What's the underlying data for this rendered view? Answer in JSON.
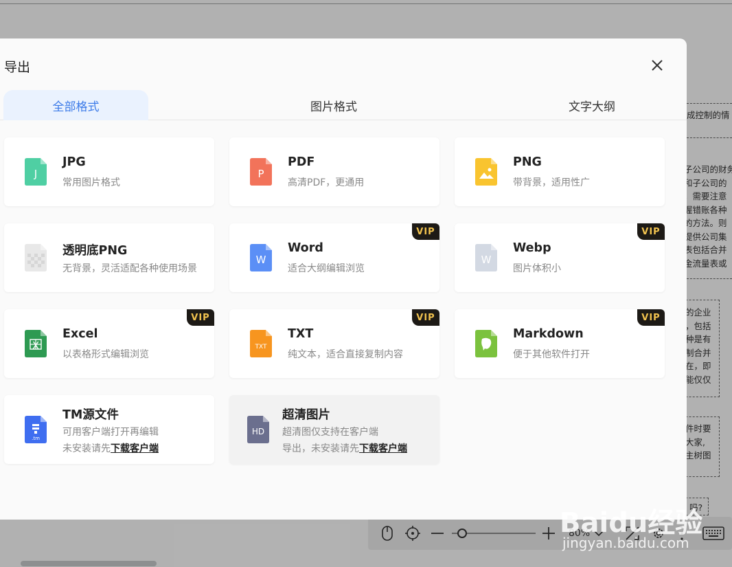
{
  "dialog": {
    "title": "导出",
    "tabs": [
      {
        "label": "全部格式",
        "active": true
      },
      {
        "label": "图片格式",
        "active": false
      },
      {
        "label": "文字大纲",
        "active": false
      }
    ]
  },
  "formats": [
    {
      "name": "JPG",
      "desc": "常用图片格式",
      "icon": "jpg-file-icon",
      "color": "#4fcfa3",
      "glyph": "J",
      "vip": false
    },
    {
      "name": "PDF",
      "desc": "高清PDF，更通用",
      "icon": "pdf-file-icon",
      "color": "#f2735a",
      "glyph": "P",
      "vip": false
    },
    {
      "name": "PNG",
      "desc": "带背景，适用性广",
      "icon": "png-file-icon",
      "color": "#f9c42f",
      "glyph": "",
      "vip": false
    },
    {
      "name": "透明底PNG",
      "desc": "无背景，灵活适配各种使用场景",
      "icon": "transparent-png-file-icon",
      "color": "#e8e8e8",
      "glyph": "",
      "vip": false
    },
    {
      "name": "Word",
      "desc": "适合大纲编辑浏览",
      "icon": "word-file-icon",
      "color": "#5b8ff6",
      "glyph": "W",
      "vip": true
    },
    {
      "name": "Webp",
      "desc": "图片体积小",
      "icon": "webp-file-icon",
      "color": "#d3d9e3",
      "glyph": "W",
      "vip": true
    },
    {
      "name": "Excel",
      "desc": "以表格形式编辑浏览",
      "icon": "excel-file-icon",
      "color": "#2e9a52",
      "glyph": "X",
      "vip": true
    },
    {
      "name": "TXT",
      "desc": "纯文本，适合直接复制内容",
      "icon": "txt-file-icon",
      "color": "#f7951f",
      "glyph": "TXT",
      "vip": true
    },
    {
      "name": "Markdown",
      "desc": "便于其他软件打开",
      "icon": "markdown-file-icon",
      "color": "#7bc23e",
      "glyph": "",
      "vip": true
    }
  ],
  "special": [
    {
      "name": "TM源文件",
      "desc": "可用客户端打开再编辑",
      "prefix": "未安装请先",
      "link": "下载客户端",
      "icon": "tm-file-icon",
      "color": "#3f6ef0",
      "glyph": ".tm"
    },
    {
      "name": "超清图片",
      "desc": "超清图仅支持在客户端",
      "prefix": "导出，未安装请先",
      "link": "下载客户端",
      "icon": "hd-file-icon",
      "color": "#6b6f8e",
      "glyph": "HD"
    }
  ],
  "vip_label": "VIP",
  "zoom": {
    "level": "80%",
    "slider_fraction": 0.12
  },
  "background_text": {
    "l1": "成控制的情",
    "block2": [
      "子公司的财务",
      "和子公司的",
      "，需要注意",
      "握错账各种",
      "的方法。则",
      "提供公司集",
      "表包括合并",
      "金流量表或"
    ],
    "block3": [
      "的企业",
      "，包括",
      "种是有",
      "制合并",
      "在，即",
      "能仅仅"
    ],
    "block4": [
      "件时要",
      "大家,",
      "主树图"
    ],
    "block5": "吗?"
  },
  "watermark": {
    "logo": "Baidu经验",
    "url": "jingyan.baidu.com"
  }
}
